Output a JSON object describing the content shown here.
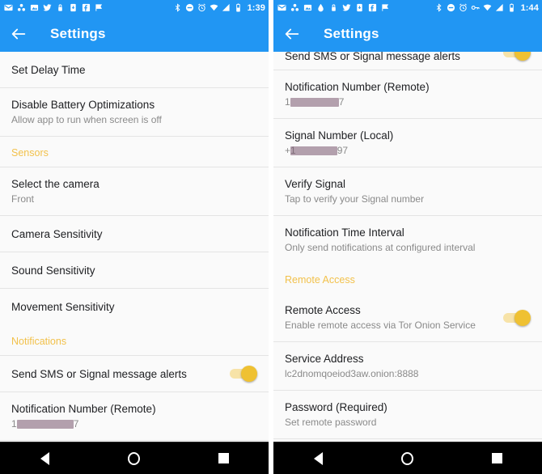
{
  "left": {
    "status_bar": {
      "time": "1:39",
      "left_icons": [
        "gmail-icon",
        "drive-icon",
        "photos-icon",
        "twitter-icon",
        "lock-icon",
        "device-icon",
        "facebook-icon",
        "flag-icon"
      ],
      "right_icons": [
        "bluetooth-icon",
        "dnd-icon",
        "alarm-icon",
        "wifi-icon",
        "cellular-icon",
        "battery-icon"
      ]
    },
    "appbar": {
      "title": "Settings",
      "back": "back-arrow"
    },
    "rows": [
      {
        "type": "item",
        "title": "Set Delay Time"
      },
      {
        "type": "item",
        "title": "Disable Battery Optimizations",
        "sub": "Allow app to run when screen is off"
      },
      {
        "type": "header",
        "title": "Sensors"
      },
      {
        "type": "item",
        "title": "Select the camera",
        "sub": "Front"
      },
      {
        "type": "item",
        "title": "Camera Sensitivity"
      },
      {
        "type": "item",
        "title": "Sound Sensitivity"
      },
      {
        "type": "item",
        "title": "Movement Sensitivity"
      },
      {
        "type": "header",
        "title": "Notifications"
      },
      {
        "type": "toggle",
        "title": "Send SMS or Signal message alerts",
        "state": "on"
      },
      {
        "type": "redacted",
        "title": "Notification Number (Remote)",
        "prefix": "1",
        "suffix": "7"
      }
    ]
  },
  "right": {
    "status_bar": {
      "time": "1:44",
      "left_icons": [
        "gmail-icon",
        "drive-icon",
        "photos-icon",
        "drop-icon",
        "lock-icon",
        "twitter-icon",
        "device-icon",
        "facebook-icon",
        "flag-icon"
      ],
      "right_icons": [
        "bluetooth-icon",
        "dnd-icon",
        "alarm-icon",
        "vpn-key-icon",
        "wifi-icon",
        "cellular-icon",
        "battery-icon"
      ]
    },
    "appbar": {
      "title": "Settings",
      "back": "back-arrow"
    },
    "rows": [
      {
        "type": "toggle_clipped",
        "title": "Send SMS or Signal message alerts",
        "state": "on"
      },
      {
        "type": "redacted",
        "title": "Notification Number (Remote)",
        "prefix": "1",
        "suffix": "7"
      },
      {
        "type": "redacted",
        "title": "Signal Number (Local)",
        "prefix": "+1",
        "suffix": "97"
      },
      {
        "type": "item",
        "title": "Verify Signal",
        "sub": "Tap to verify your Signal number"
      },
      {
        "type": "item",
        "title": "Notification Time Interval",
        "sub": "Only send notifications at configured interval"
      },
      {
        "type": "header",
        "title": "Remote Access"
      },
      {
        "type": "toggle",
        "title": "Remote Access",
        "sub": "Enable remote access via Tor Onion Service",
        "state": "on"
      },
      {
        "type": "item",
        "title": "Service Address",
        "sub": "lc2dnomqoeiod3aw.onion:8888"
      },
      {
        "type": "item",
        "title": "Password (Required)",
        "sub": "Set remote password"
      }
    ]
  },
  "navbar": {
    "back_label": "back-button",
    "home_label": "home-button",
    "recents_label": "recents-button"
  },
  "colors": {
    "primary": "#2196f3",
    "accent": "#f2c14b",
    "toggle_on": "#efc132",
    "background": "#fafafa",
    "text": "#202124",
    "subtext": "#8a8a8a"
  }
}
